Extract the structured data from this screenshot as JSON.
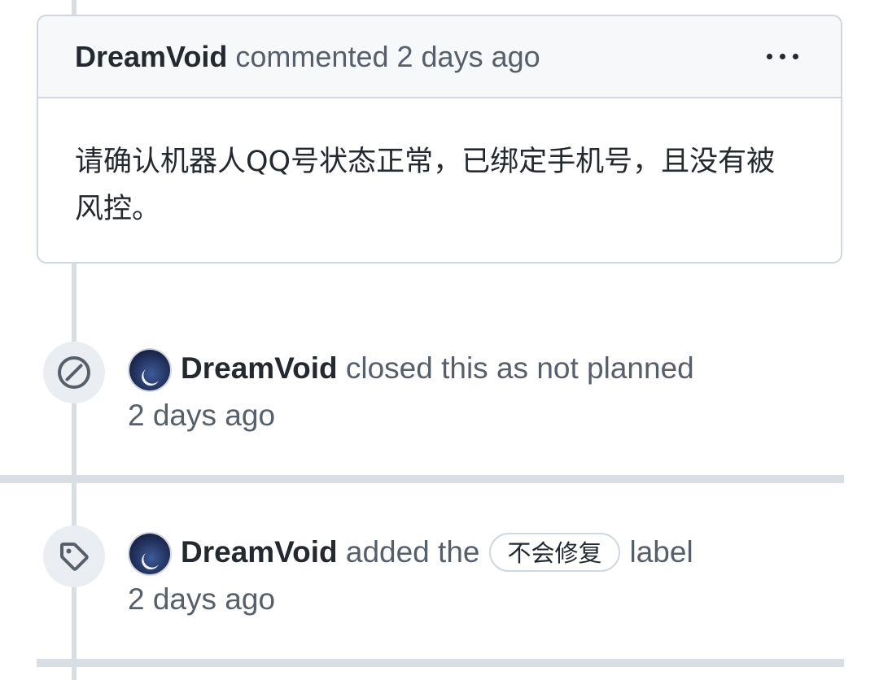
{
  "comment": {
    "author": "DreamVoid",
    "action": "commented",
    "time": "2 days ago",
    "body": "请确认机器人QQ号状态正常，已绑定手机号，且没有被风控。"
  },
  "events": [
    {
      "icon": "circle-slash-icon",
      "author": "DreamVoid",
      "text": "closed this as not planned",
      "time": "2 days ago"
    },
    {
      "icon": "tag-icon",
      "author": "DreamVoid",
      "text_before": "added the",
      "label": "不会修复",
      "text_after": "label",
      "time": "2 days ago"
    }
  ],
  "colors": {
    "border": "#d0d7de",
    "header_bg": "#f6f8fa",
    "muted_text": "#57606a",
    "timeline": "#d8dee4"
  }
}
